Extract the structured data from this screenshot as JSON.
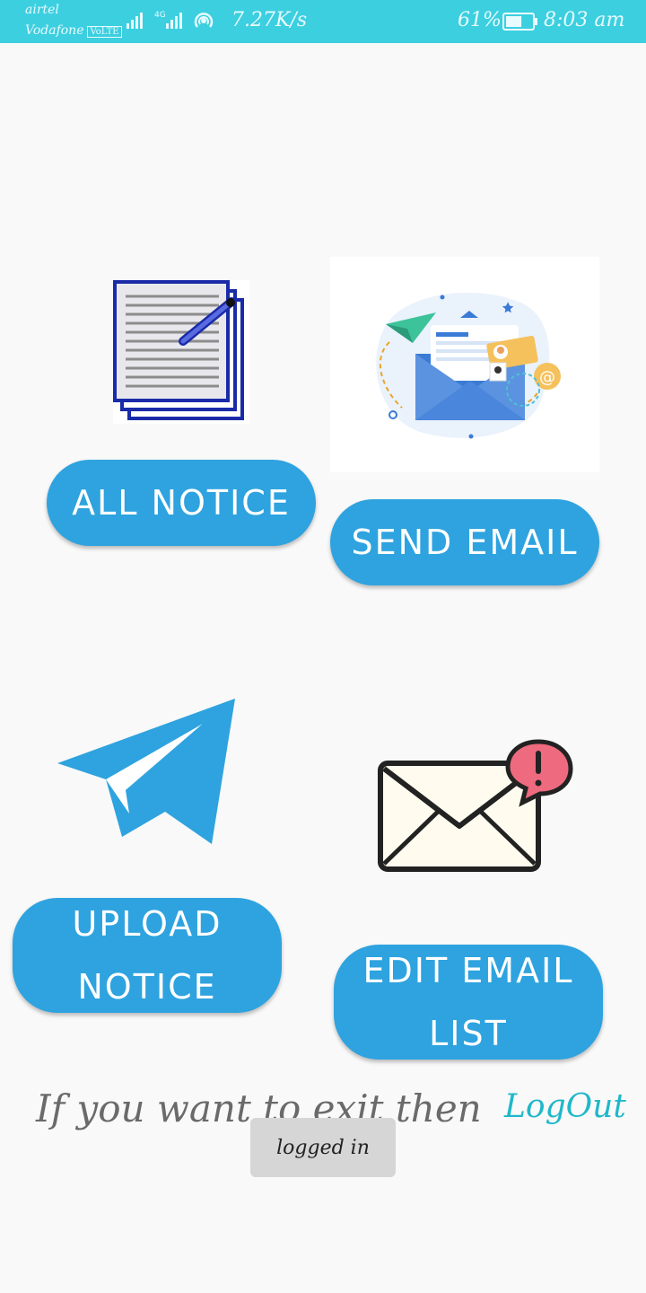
{
  "status_bar": {
    "carrier_1": "airtel",
    "carrier_2": "Vodafone",
    "volte_badge": "VoLTE",
    "network_type": "4G",
    "speed": "7.27K/s",
    "battery_percent": "61%",
    "battery_level": 0.61,
    "time": "8:03 am",
    "background_color": "#3ccfdf"
  },
  "cards": {
    "all_notice": {
      "icon": "notepad-icon",
      "label": "ALL NOTICE"
    },
    "send_email": {
      "icon": "email-illustration-icon",
      "label": "SEND EMAIL"
    },
    "upload_notice": {
      "icon": "paper-plane-icon",
      "label_line1": "UPLOAD",
      "label_line2": "NOTICE"
    },
    "edit_email_list": {
      "icon": "mail-alert-icon",
      "label_line1": "EDIT EMAIL",
      "label_line2": "LIST"
    }
  },
  "footer": {
    "prompt_text": "If you want to exit then",
    "logout_label": "LogOut"
  },
  "toast": {
    "message": "logged in"
  },
  "colors": {
    "button_blue": "#2ea3df",
    "link_teal": "#1fb8c9",
    "background": "#f9f9f9"
  }
}
